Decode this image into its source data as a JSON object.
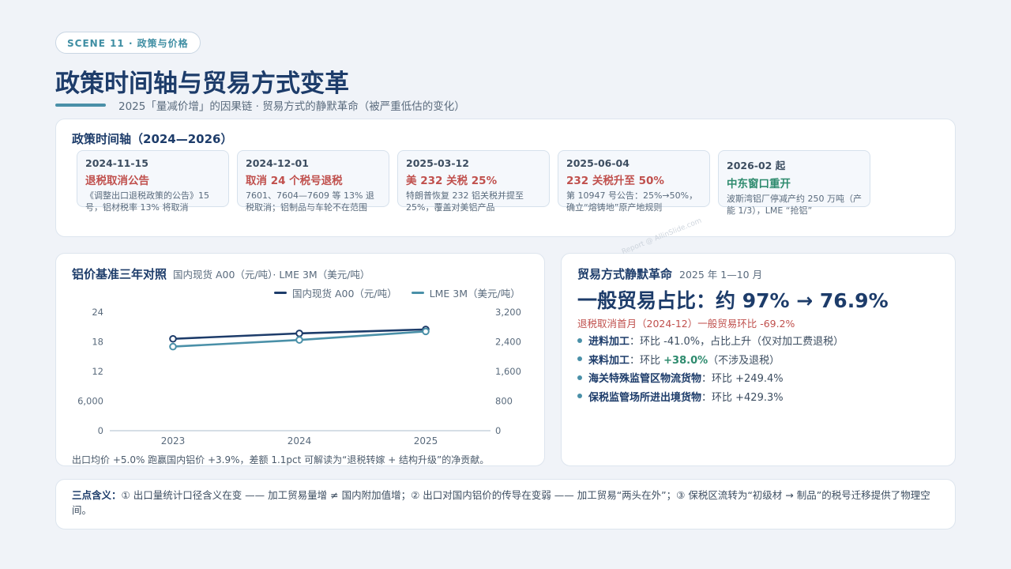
{
  "header": {
    "scene_pill": "SCENE 11 · 政策与价格",
    "title": "政策时间轴与贸易方式变革",
    "subtitle": "2025「量减价增」的因果链 · 贸易方式的静默革命（被严重低估的变化）"
  },
  "timeline": {
    "title": "政策时间轴（2024—2026）",
    "items": [
      {
        "date": "2024-11-15",
        "headline": "退税取消公告",
        "desc": "《调整出口退税政策的公告》15号，铝材税率 13% 将取消"
      },
      {
        "date": "2024-12-01",
        "headline": "取消 24 个税号退税",
        "desc": "7601、7604—7609 等 13% 退税取消；铝制品与车轮不在范围"
      },
      {
        "date": "2025-03-12",
        "headline": "美 232 关税 25%",
        "desc": "特朗普恢复 232 铝关税并提至 25%，覆盖对美铝产品"
      },
      {
        "date": "2025-06-04",
        "headline": "232 关税升至 50%",
        "desc": "第 10947 号公告：25%→50%，确立“熔铸地”原产地规则"
      },
      {
        "date": "2026-02 起",
        "headline": "中东窗口重开",
        "desc": "波斯湾铝厂停减产约 250 万吨（产能 1/3），LME “抢铝”"
      }
    ],
    "colors": {
      "red": "#c0504d",
      "green": "#2e8b6e"
    }
  },
  "price_chart": {
    "title": "铝价基准三年对照",
    "subtitle": "国内现货 A00（元/吨）· LME 3M（美元/吨）",
    "note": "出口均价 +5.0% 跑赢国内铝价 +3.9%，差额 1.1pct 可解读为“退税转嫁 + 结构升级”的净贡献。"
  },
  "chart_data": {
    "type": "line",
    "x": [
      "2023",
      "2024",
      "2025"
    ],
    "series": [
      {
        "name": "国内现货 A00（元/吨）",
        "axis": "left",
        "color": "#1d3c6a",
        "values": [
          18600,
          19700,
          20500
        ]
      },
      {
        "name": "LME 3M（美元/吨）",
        "axis": "right",
        "color": "#4a90a8",
        "values": [
          2270,
          2450,
          2680
        ]
      }
    ],
    "y_left": {
      "ticks": [
        "24",
        "18",
        "12",
        "6,000",
        "0"
      ],
      "range": [
        0,
        24000
      ]
    },
    "y_right": {
      "ticks": [
        "3,200",
        "2,400",
        "1,600",
        "800",
        "0"
      ],
      "range": [
        0,
        3200
      ]
    },
    "legend": "top-right",
    "grid": false
  },
  "trade": {
    "title": "贸易方式静默革命",
    "period": "2025 年 1—10 月",
    "headline": "一般贸易占比：约 97% → 76.9%",
    "note": "退税取消首月（2024-12）一般贸易环比 -69.2%",
    "bullets": [
      {
        "label": "进料加工",
        "value": "：环比 -41.0%，占比上升（仅对加工费退税）"
      },
      {
        "label": "来料加工",
        "value_pre": "：环比 ",
        "value_em": "+38.0%",
        "value_post": "（不涉及退税）"
      },
      {
        "label": "海关特殊监管区物流货物",
        "value": "：环比 +249.4%"
      },
      {
        "label": "保税监管场所进出境货物",
        "value": "：环比 +429.3%"
      }
    ]
  },
  "implications": {
    "label": "三点含义：",
    "text": "① 出口量统计口径含义在变 —— 加工贸易量增 ≠ 国内附加值增；② 出口对国内铝价的传导在变弱 —— 加工贸易“两头在外”；③ 保税区流转为“初级材 → 制品”的税号迁移提供了物理空间。"
  },
  "watermark": "Report @ AllinSlide.com"
}
